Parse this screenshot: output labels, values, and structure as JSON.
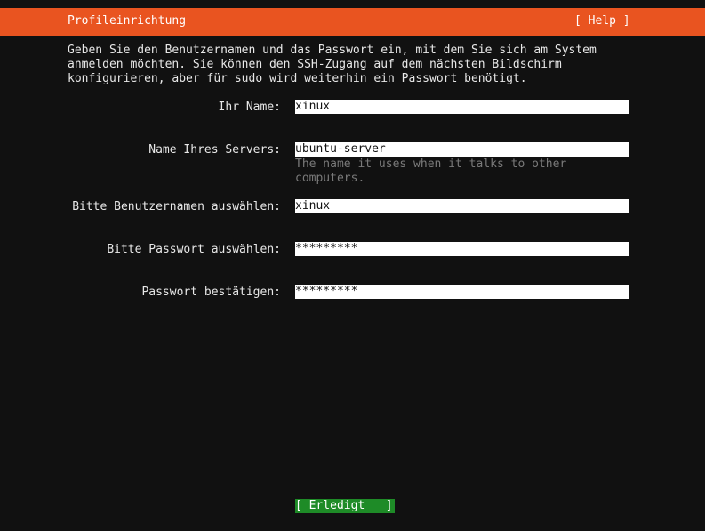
{
  "header": {
    "title": "Profileinrichtung",
    "help_label": "[ Help ]"
  },
  "intro": {
    "line1": "Geben Sie den Benutzernamen und das Passwort ein, mit dem Sie sich am System",
    "line2": "anmelden möchten. Sie können den SSH-Zugang auf dem nächsten Bildschirm",
    "line3": "konfigurieren, aber für sudo wird weiterhin ein Passwort benötigt."
  },
  "form": {
    "name": {
      "label": "Ihr Name:",
      "value": "xinux"
    },
    "server": {
      "label": "Name Ihres Servers:",
      "value": "ubuntu-server",
      "hint_line1": "The name it uses when it talks to other",
      "hint_line2": "computers."
    },
    "username": {
      "label": "Bitte Benutzernamen auswählen:",
      "value": "xinux"
    },
    "password": {
      "label": "Bitte Passwort auswählen:",
      "value": "*********"
    },
    "confirm": {
      "label": "Passwort bestätigen:",
      "value": "*********"
    }
  },
  "footer": {
    "done_label": "[ Erledigt   ]"
  },
  "colors": {
    "accent": "#e95420",
    "background": "#111111",
    "button": "#1e8b27"
  }
}
